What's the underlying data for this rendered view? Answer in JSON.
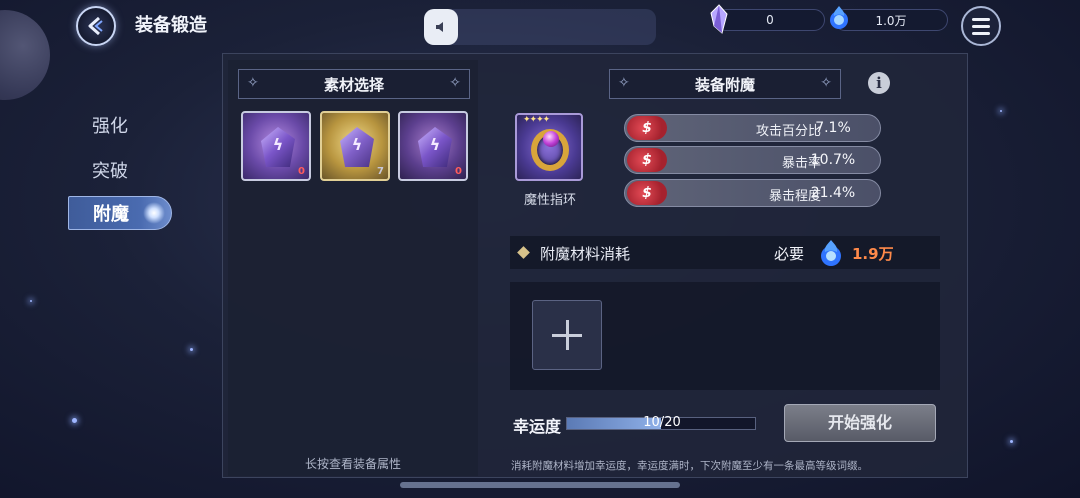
{
  "header": {
    "title": "装备锻造",
    "back_icon": "back-arrow-icon",
    "menu_icon": "hamburger-menu-icon",
    "volume_icon": "speaker-icon"
  },
  "resources": {
    "gem": {
      "icon": "crystal-shard-icon",
      "value": "0"
    },
    "soul": {
      "icon": "blue-soul-flame-icon",
      "value": "1.0万"
    }
  },
  "nav": {
    "items": [
      {
        "label": "强化"
      },
      {
        "label": "突破"
      },
      {
        "label": "附魔"
      }
    ],
    "active_index": 2
  },
  "materials": {
    "title": "素材选择",
    "slots": [
      {
        "icon": "purple-crystal-icon",
        "count": "0",
        "rarity": "purple"
      },
      {
        "icon": "gold-crystal-icon",
        "count": "7",
        "rarity": "gold"
      },
      {
        "icon": "violet-crystal-icon",
        "count": "0",
        "rarity": "violet"
      }
    ],
    "hint": "长按查看装备属性"
  },
  "enchant": {
    "title": "装备附魔",
    "info_icon": "info-icon",
    "item": {
      "name": "魔性指环",
      "icon": "ring-icon",
      "stars": "✦✦✦✦"
    },
    "stats": [
      {
        "name": "攻击百分比",
        "value": "7.1%"
      },
      {
        "name": "暴击率",
        "value": "10.7%"
      },
      {
        "name": "暴击程度",
        "value": "21.4%"
      }
    ],
    "cost": {
      "label": "附魔材料消耗",
      "required_label": "必要",
      "amount": "1.9万"
    },
    "luck": {
      "label": "幸运度",
      "text": "10/20",
      "fraction": 0.5
    },
    "start_button": "开始强化",
    "hint": "消耗附魔材料增加幸运度，幸运度满时，下次附魔至少有一条最高等级词缀。"
  },
  "colors": {
    "accent_blue": "#4a6bb0",
    "cost_orange": "#ff8a4a",
    "stat_red": "#e34a55"
  }
}
